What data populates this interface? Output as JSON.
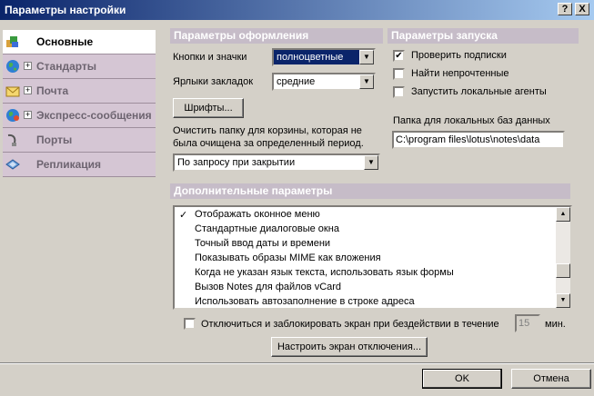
{
  "window": {
    "title": "Параметры настройки",
    "help_label": "?",
    "close_label": "X"
  },
  "sidebar": {
    "items": [
      {
        "label": "Основные",
        "icon": "basics-icon",
        "expandable": false,
        "active": true
      },
      {
        "label": "Стандарты",
        "icon": "globe-icon",
        "expandable": true
      },
      {
        "label": "Почта",
        "icon": "envelope-icon",
        "expandable": true
      },
      {
        "label": "Экспресс-сообщения",
        "icon": "globe-messaging-icon",
        "expandable": true
      },
      {
        "label": "Порты",
        "icon": "port-plug-icon",
        "expandable": false
      },
      {
        "label": "Репликация",
        "icon": "replication-icon",
        "expandable": false
      }
    ]
  },
  "appearance": {
    "header": "Параметры оформления",
    "buttons_icons_label": "Кнопки и значки",
    "buttons_icons_value": "полноцветные",
    "tabs_label": "Ярлыки закладок",
    "tabs_value": "средние",
    "fonts_button": "Шрифты...",
    "trash_text_line1": "Очистить папку для корзины, которая не",
    "trash_text_line2": "была очищена за определенный период.",
    "trash_value": "По запросу при закрытии"
  },
  "startup": {
    "header": "Параметры запуска",
    "options": [
      {
        "label": "Проверить подписки",
        "checked": true
      },
      {
        "label": "Найти непрочтенные",
        "checked": false
      },
      {
        "label": "Запустить локальные агенты",
        "checked": false
      }
    ],
    "local_db_label": "Папка для локальных баз данных",
    "local_db_value": "C:\\program files\\lotus\\notes\\data"
  },
  "additional": {
    "header": "Дополнительные параметры",
    "items": [
      {
        "label": "Отображать оконное меню",
        "checked": true
      },
      {
        "label": "Стандартные диалоговые окна",
        "checked": false
      },
      {
        "label": "Точный ввод даты и времени",
        "checked": false
      },
      {
        "label": "Показывать образы MIME как вложения",
        "checked": false
      },
      {
        "label": "Когда не указан язык текста, использовать язык формы",
        "checked": false
      },
      {
        "label": "Вызов Notes для файлов vCard",
        "checked": false
      },
      {
        "label": "Использовать автозаполнение в строке адреса",
        "checked": false
      }
    ],
    "check_glyph": "✓"
  },
  "lockout": {
    "label": "Отключиться и заблокировать экран при бездействии в течение",
    "minutes_value": "15",
    "minutes_unit": "мин.",
    "checked": false,
    "configure_button": "Настроить экран отключения..."
  },
  "footer": {
    "ok_label": "OK",
    "cancel_label": "Отмена"
  },
  "colors": {
    "dialog_bg": "#d4d0c8",
    "title_gradient_start": "#0a246a",
    "title_gradient_end": "#a6caf0",
    "section_header_bg": "#c6bcc8",
    "sidebar_item_bg": "#d5c6d4",
    "sidebar_item_text": "#6d6470"
  }
}
